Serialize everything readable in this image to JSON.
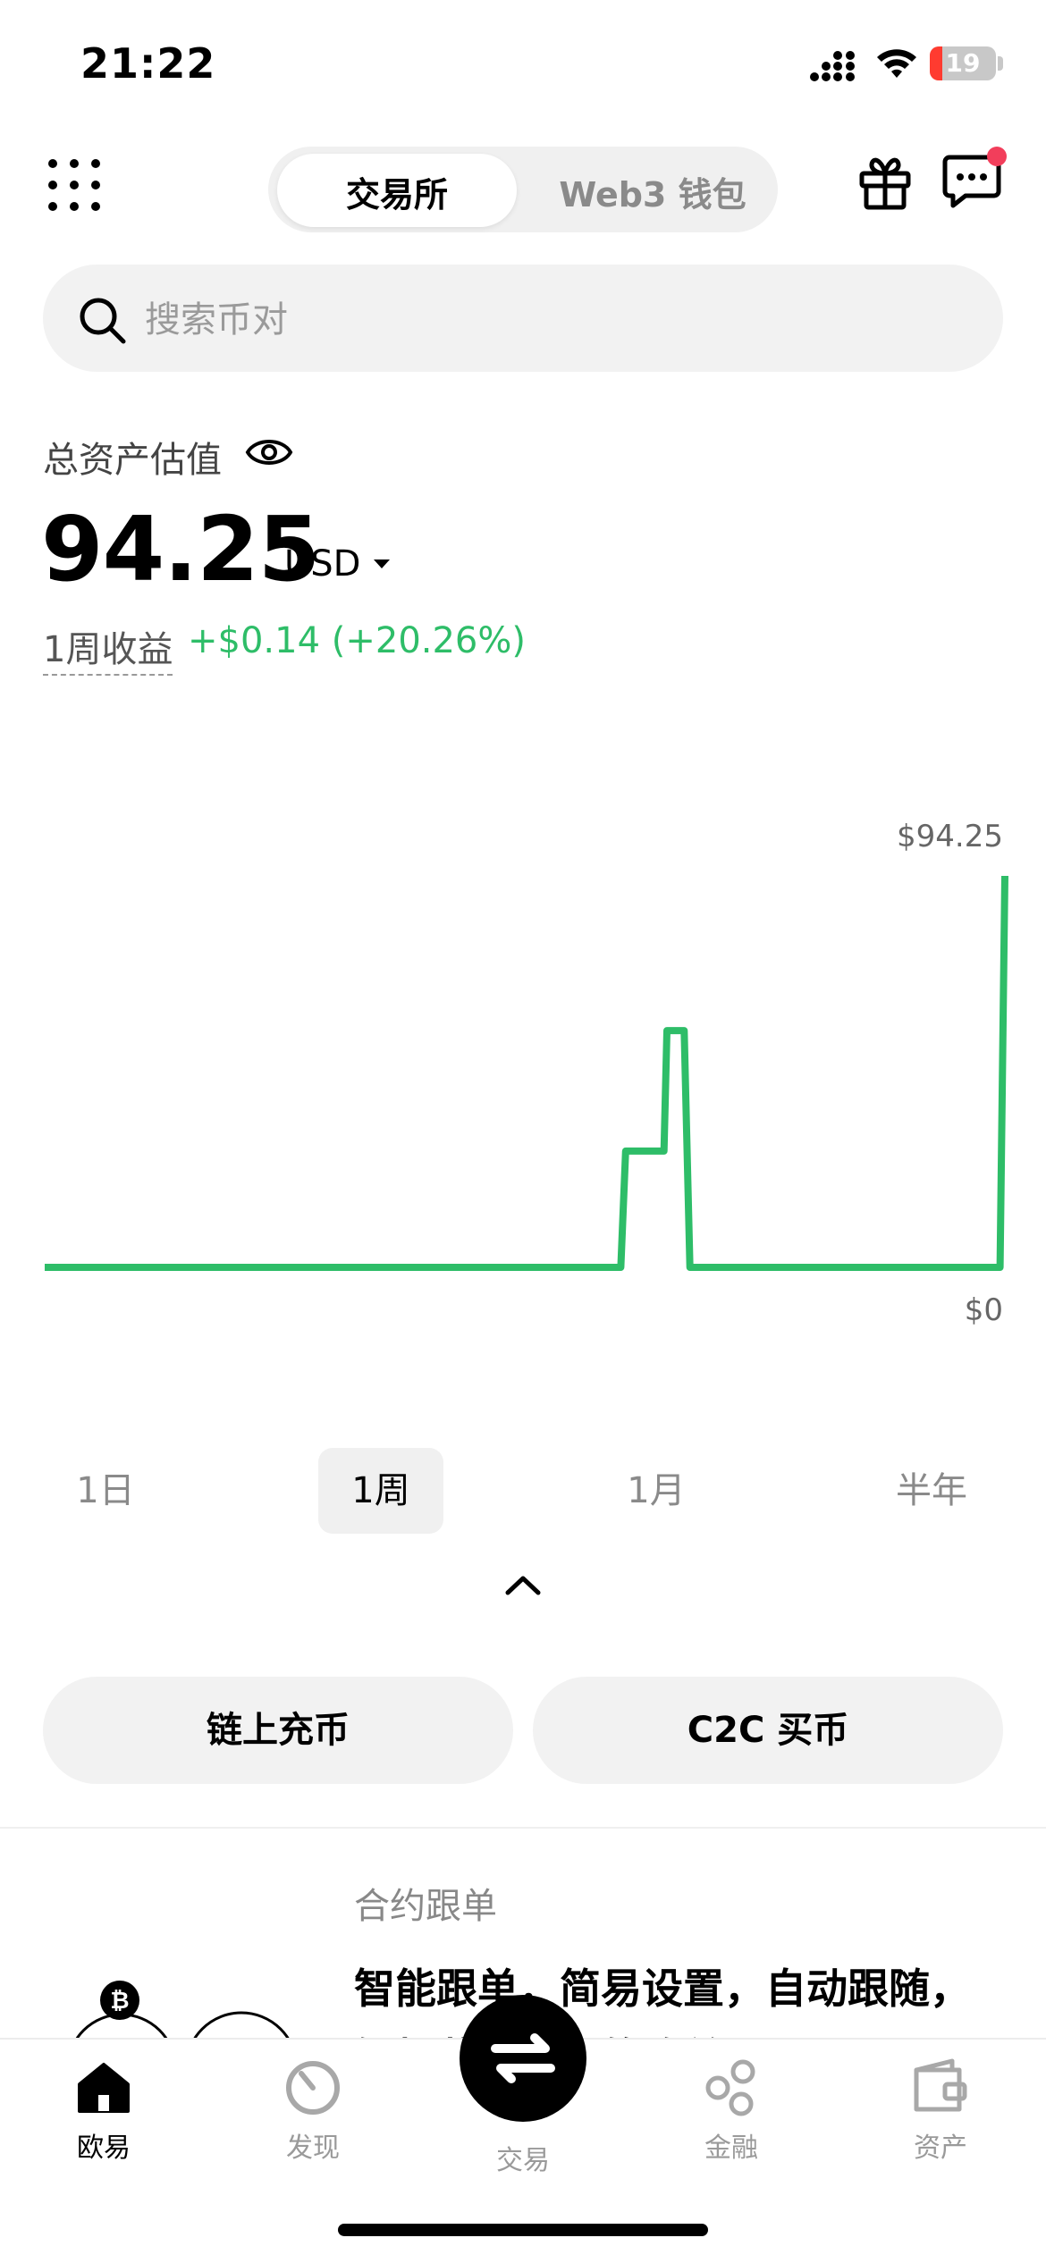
{
  "status_bar": {
    "time": "21:22",
    "battery_level": "19",
    "battery_color": "#ff3b30"
  },
  "header": {
    "menu_icon": "grid-dots-icon",
    "tabs": [
      {
        "label": "交易所",
        "active": true
      },
      {
        "label": "Web3 钱包",
        "active": false
      }
    ],
    "gift_icon": "gift-icon",
    "chat_icon": "chat-bubble-icon",
    "notification_dot_color": "#f23e5b"
  },
  "search": {
    "placeholder": "搜索币对"
  },
  "assets": {
    "title": "总资产估值",
    "value": "94.25",
    "currency": "USD",
    "pnl_label": "1周收益",
    "pnl_value": "+$0.14 (+20.26%)",
    "pnl_color": "#2ebd68"
  },
  "chart_data": {
    "type": "line",
    "line_color": "#2ebd68",
    "max_label": "$94.25",
    "min_label": "$0",
    "ylim": [
      0,
      94.25
    ],
    "x": [
      0,
      0.6,
      0.605,
      0.645,
      0.645,
      0.648,
      0.662,
      0.666,
      0.672,
      0.995,
      1.0
    ],
    "y": [
      0,
      0,
      28,
      28,
      28,
      57,
      57,
      57,
      0,
      0,
      94.25
    ]
  },
  "range_tabs": [
    {
      "label": "1日",
      "active": false
    },
    {
      "label": "1周",
      "active": true
    },
    {
      "label": "1月",
      "active": false
    },
    {
      "label": "半年",
      "active": false
    }
  ],
  "actions": {
    "deposit": "链上充币",
    "c2c": "C2C 买币"
  },
  "card": {
    "tag": "合约跟单",
    "description": "智能跟单，简易设置，自动跟随，轻松获取潜在的收益"
  },
  "tabbar": {
    "items": [
      {
        "label": "欧易",
        "icon": "home-icon",
        "active": true
      },
      {
        "label": "发现",
        "icon": "discover-icon",
        "active": false
      },
      {
        "label": "交易",
        "icon": "swap-icon",
        "active": false
      },
      {
        "label": "金融",
        "icon": "finance-icon",
        "active": false
      },
      {
        "label": "资产",
        "icon": "wallet-icon",
        "active": false
      }
    ]
  }
}
